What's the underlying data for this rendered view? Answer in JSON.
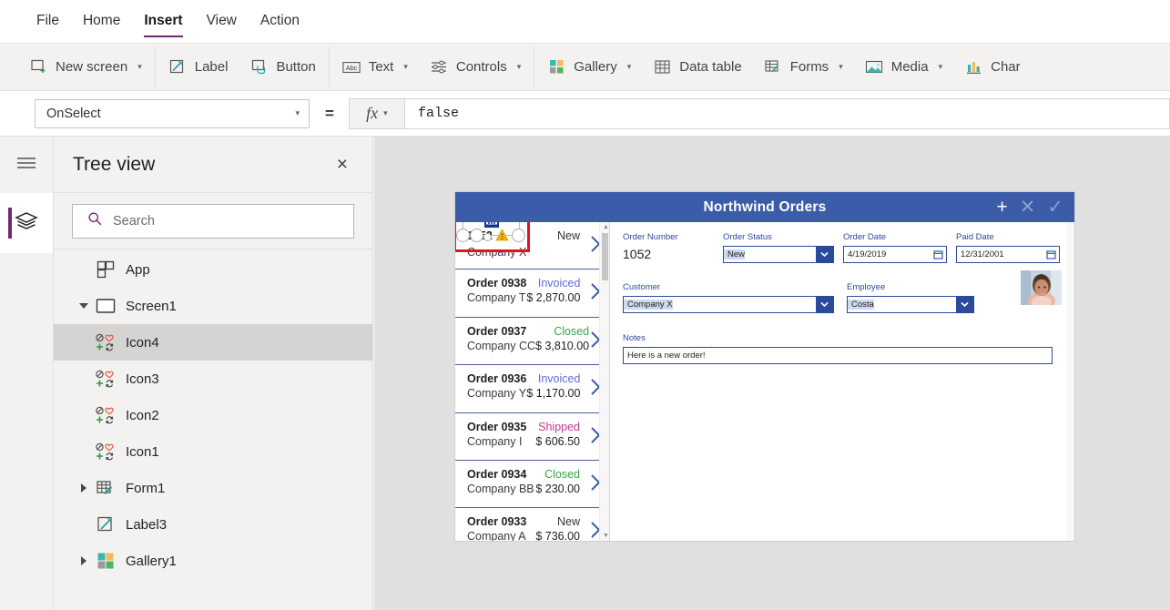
{
  "menubar": {
    "items": [
      {
        "label": "File",
        "active": false
      },
      {
        "label": "Home",
        "active": false
      },
      {
        "label": "Insert",
        "active": true
      },
      {
        "label": "View",
        "active": false
      },
      {
        "label": "Action",
        "active": false
      }
    ]
  },
  "ribbon": {
    "items": [
      {
        "label": "New screen",
        "icon": "new-screen-icon",
        "caret": true
      },
      {
        "label": "Label",
        "icon": "label-icon",
        "caret": false
      },
      {
        "label": "Button",
        "icon": "button-icon",
        "caret": false
      },
      {
        "label": "Text",
        "icon": "text-abc-icon",
        "caret": true
      },
      {
        "label": "Controls",
        "icon": "controls-sliders-icon",
        "caret": true
      },
      {
        "label": "Gallery",
        "icon": "gallery-grid-icon",
        "caret": true
      },
      {
        "label": "Data table",
        "icon": "data-table-icon",
        "caret": false
      },
      {
        "label": "Forms",
        "icon": "forms-icon",
        "caret": true
      },
      {
        "label": "Media",
        "icon": "media-image-icon",
        "caret": true
      },
      {
        "label": "Char",
        "icon": "charts-bar-icon",
        "caret": false
      }
    ]
  },
  "formula_bar": {
    "property": "OnSelect",
    "equals": "=",
    "fx_label": "fx",
    "formula": "false"
  },
  "rail": {
    "hamburger": "hamburger-icon",
    "active_tool": "tree-view-layers-icon"
  },
  "treeview": {
    "title": "Tree view",
    "close": "×",
    "search_placeholder": "Search",
    "search_value": "",
    "nodes": [
      {
        "label": "App",
        "icon": "app-icon",
        "indent": 1,
        "twisty": "none",
        "selected": false
      },
      {
        "label": "Screen1",
        "icon": "screen-icon",
        "indent": 1,
        "twisty": "expanded",
        "selected": false
      },
      {
        "label": "Icon4",
        "icon": "icons-group-icon",
        "indent": 2,
        "twisty": "none",
        "selected": true
      },
      {
        "label": "Icon3",
        "icon": "icons-group-icon",
        "indent": 2,
        "twisty": "none",
        "selected": false
      },
      {
        "label": "Icon2",
        "icon": "icons-group-icon",
        "indent": 2,
        "twisty": "none",
        "selected": false
      },
      {
        "label": "Icon1",
        "icon": "icons-group-icon",
        "indent": 2,
        "twisty": "none",
        "selected": false
      },
      {
        "label": "Form1",
        "icon": "form-icon",
        "indent": 2,
        "twisty": "collapsed",
        "selected": false
      },
      {
        "label": "Label3",
        "icon": "label-icon",
        "indent": 2,
        "twisty": "none",
        "selected": false
      },
      {
        "label": "Gallery1",
        "icon": "gallery-grid-icon",
        "indent": 2,
        "twisty": "collapsed",
        "selected": false
      }
    ]
  },
  "app_preview": {
    "header": {
      "title": "Northwind Orders",
      "background": "#3b5ca8",
      "actions": [
        {
          "name": "add-icon",
          "glyph": "+",
          "dim": false
        },
        {
          "name": "cancel-icon",
          "glyph": "✕",
          "dim": true
        },
        {
          "name": "confirm-icon",
          "glyph": "✓",
          "dim": true
        }
      ]
    },
    "selection": {
      "control": "trash-icon",
      "border_color": "#e81123",
      "handles": 8
    },
    "gallery": {
      "rows": [
        {
          "order": "1052",
          "company": "Company X",
          "status": "New",
          "status_color": "#333333",
          "amount": "",
          "warning": true,
          "selected": true
        },
        {
          "order": "Order 0938",
          "company": "Company T",
          "status": "Invoiced",
          "status_color": "#5b6fd6",
          "amount": "$ 2,870.00",
          "warning": false,
          "selected": false
        },
        {
          "order": "Order 0937",
          "company": "Company CC",
          "status": "Closed",
          "status_color": "#3ea34a",
          "amount": "$ 3,810.00",
          "warning": false,
          "selected": false
        },
        {
          "order": "Order 0936",
          "company": "Company Y",
          "status": "Invoiced",
          "status_color": "#5b6fd6",
          "amount": "$ 1,170.00",
          "warning": false,
          "selected": false
        },
        {
          "order": "Order 0935",
          "company": "Company I",
          "status": "Shipped",
          "status_color": "#c23a8e",
          "amount": "$ 606.50",
          "warning": false,
          "selected": false
        },
        {
          "order": "Order 0934",
          "company": "Company BB",
          "status": "Closed",
          "status_color": "#3ea34a",
          "amount": "$ 230.00",
          "warning": false,
          "selected": false
        },
        {
          "order": "Order 0933",
          "company": "Company A",
          "status": "New",
          "status_color": "#333333",
          "amount": "$ 736.00",
          "warning": false,
          "selected": false
        }
      ]
    },
    "form": {
      "order_number": {
        "label": "Order Number",
        "value": "1052"
      },
      "order_status": {
        "label": "Order Status",
        "value": "New",
        "type": "dropdown"
      },
      "order_date": {
        "label": "Order Date",
        "value": "4/19/2019",
        "type": "date"
      },
      "paid_date": {
        "label": "Paid Date",
        "value": "12/31/2001",
        "type": "date"
      },
      "customer": {
        "label": "Customer",
        "value": "Company X",
        "type": "dropdown"
      },
      "employee": {
        "label": "Employee",
        "value": "Costa",
        "type": "dropdown"
      },
      "notes": {
        "label": "Notes",
        "value": "Here is a new order!",
        "type": "text"
      },
      "employee_photo": "employee-avatar"
    }
  }
}
